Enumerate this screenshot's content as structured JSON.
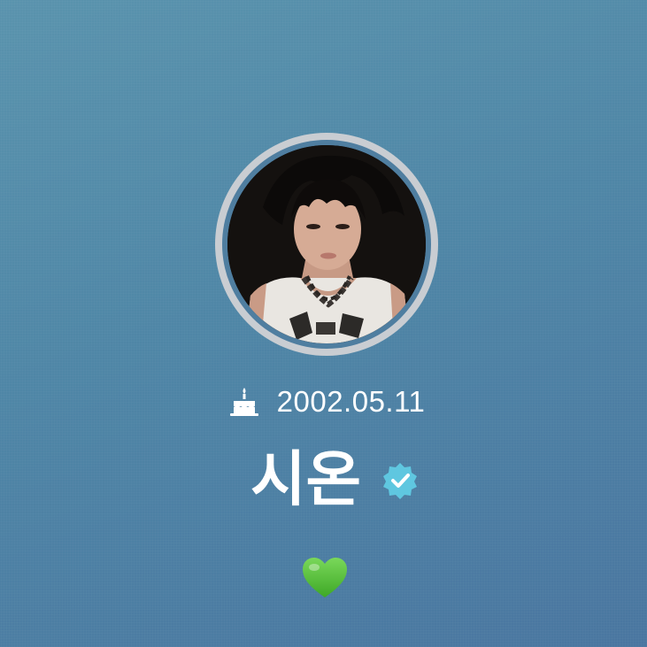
{
  "profile": {
    "birthday": "2002.05.11",
    "name": "시온",
    "verified": true,
    "status_emoji": "💚"
  },
  "icons": {
    "birthday_icon": "cake-icon",
    "verified_icon": "verified-badge-icon",
    "status_icon": "green-heart-icon"
  },
  "colors": {
    "background_top": "#5a93ad",
    "background_bottom": "#4a76a0",
    "avatar_ring": "#c9cdd2",
    "verified_badge": "#5fc7e0",
    "heart": "#5ac73a",
    "text": "#ffffff"
  }
}
